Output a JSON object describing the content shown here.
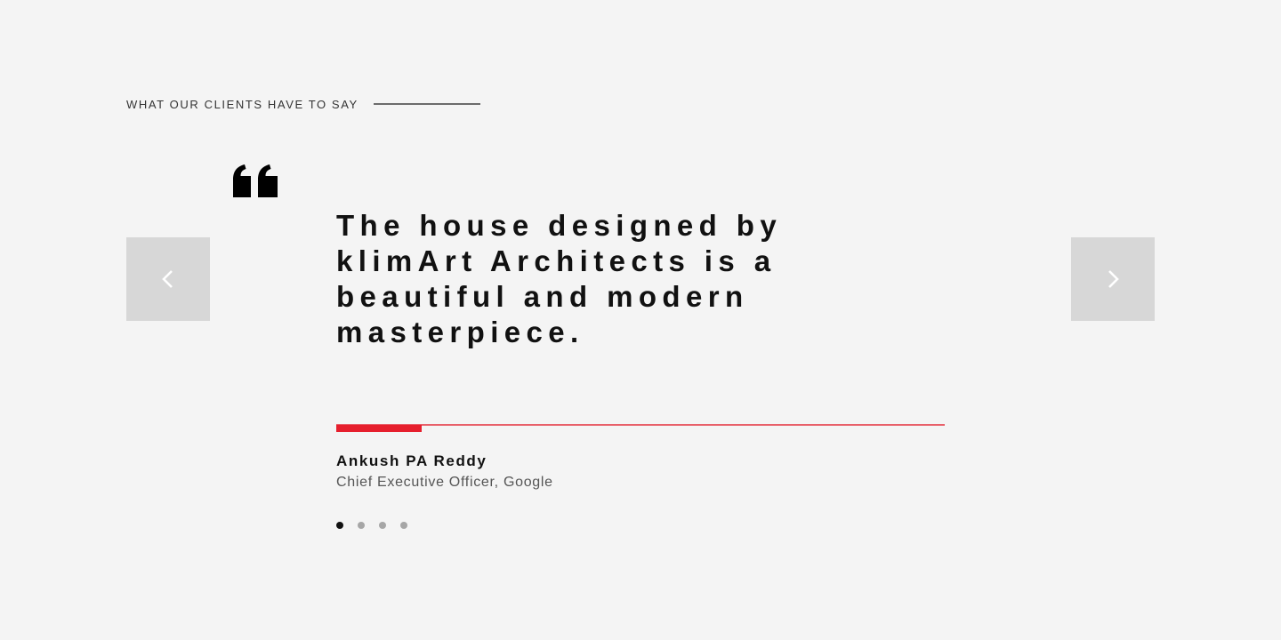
{
  "testimonials": {
    "eyebrow": "WHAT OUR CLIENTS HAVE TO SAY",
    "quote_icon": "quote-open-icon",
    "quote": "The house designed by klimArt Architects is a beautiful and modern masterpiece.",
    "author": {
      "name": "Ankush PA Reddy",
      "title": "Chief Executive Officer, Google"
    },
    "progress": 0.14,
    "slides": {
      "count": 4,
      "active_index": 0
    },
    "nav": {
      "prev_icon": "chevron-left-icon",
      "next_icon": "chevron-right-icon"
    },
    "colors": {
      "background": "#f4f4f4",
      "accent": "#e61f2d",
      "text": "#111111",
      "nav_button": "#d7d7d7"
    }
  }
}
